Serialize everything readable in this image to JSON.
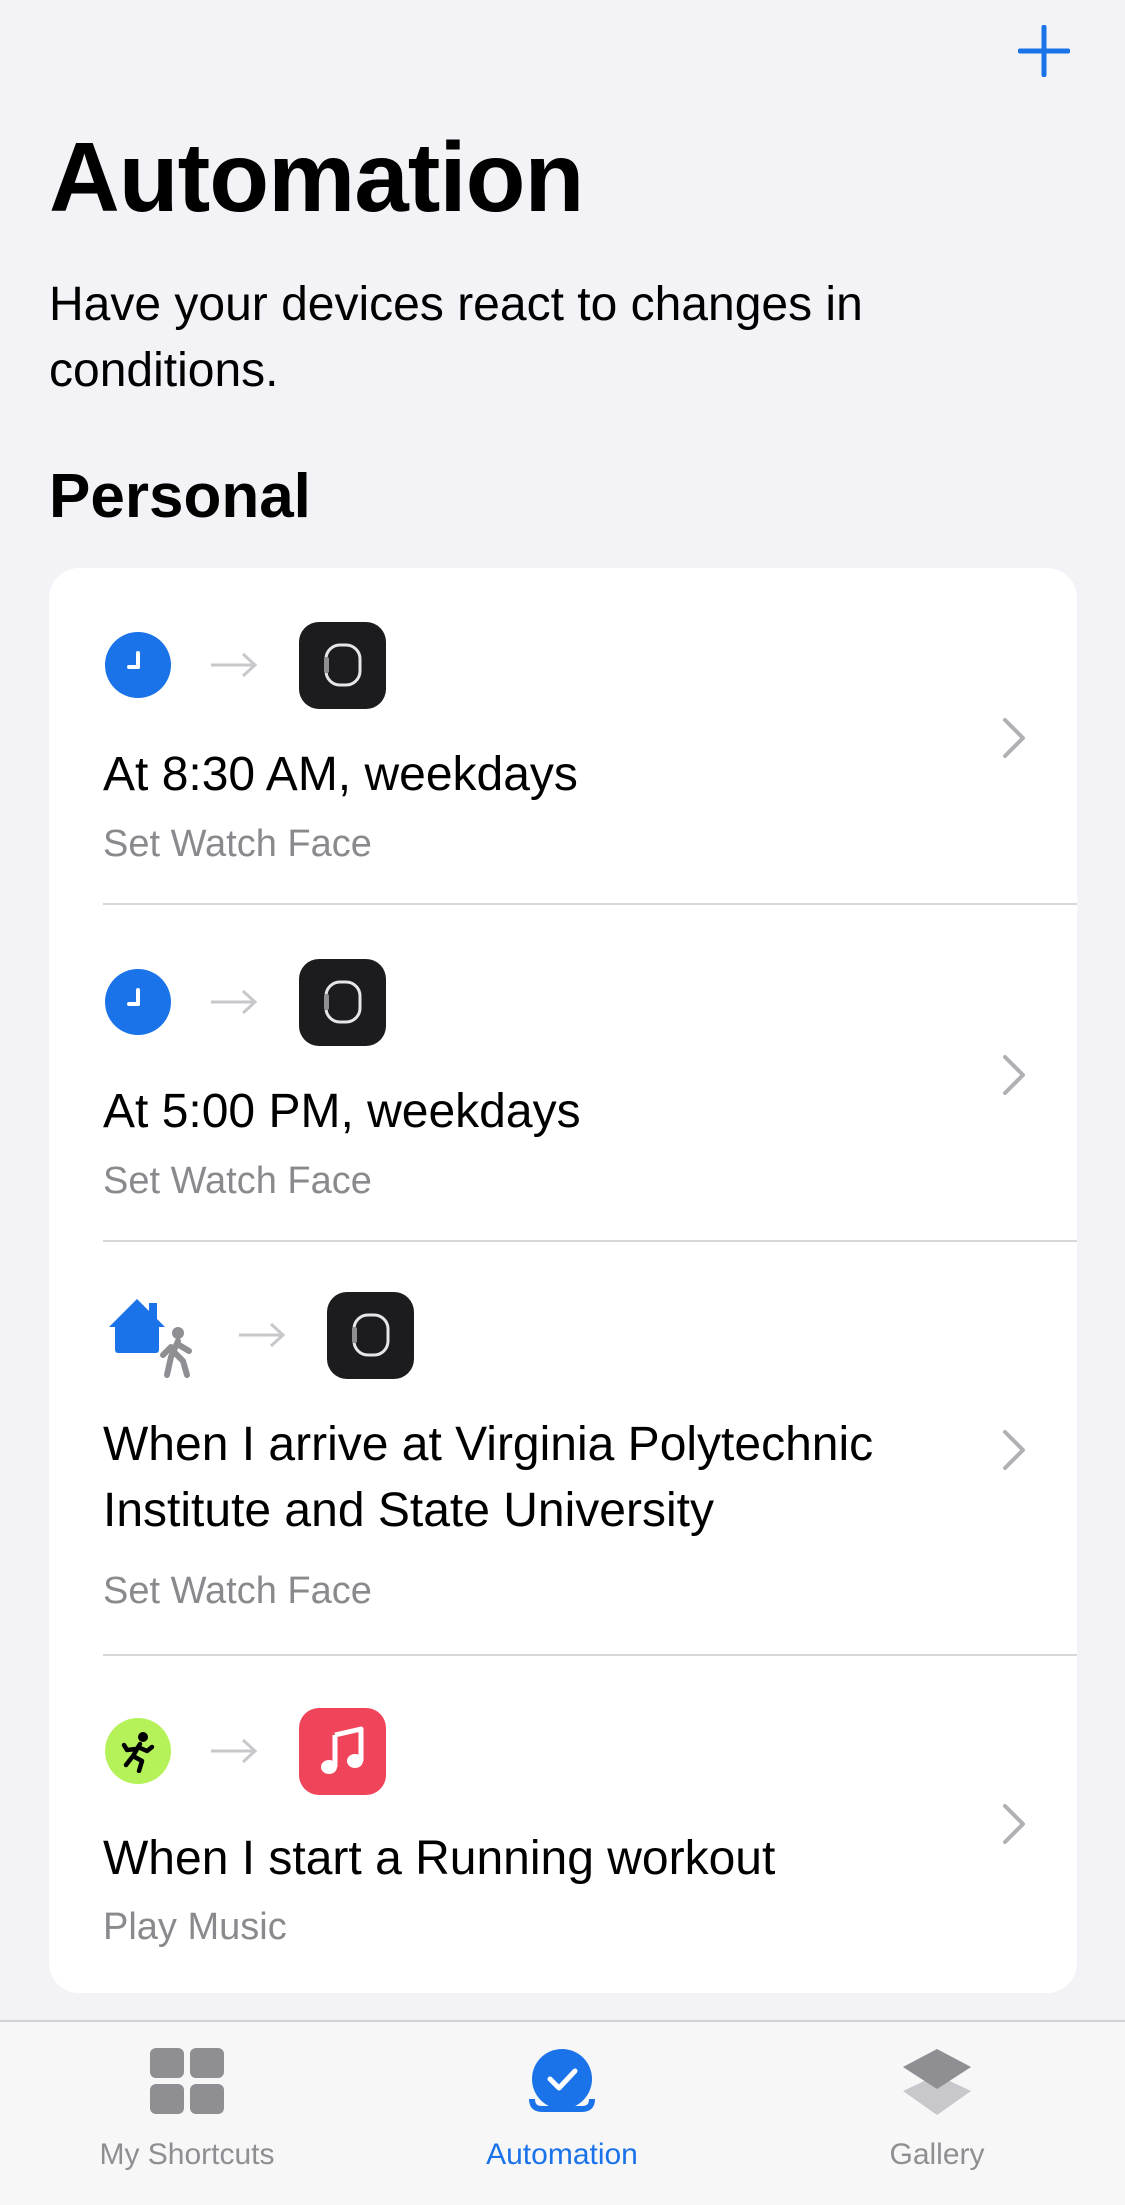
{
  "header": {
    "title": "Automation",
    "subtitle": "Have your devices react to changes in conditions."
  },
  "section": {
    "title": "Personal"
  },
  "automations": [
    {
      "trigger_icon": "clock-icon",
      "action_icon": "watch-face-icon",
      "title": "At 8:30 AM, weekdays",
      "action": "Set Watch Face"
    },
    {
      "trigger_icon": "clock-icon",
      "action_icon": "watch-face-icon",
      "title": "At 5:00 PM, weekdays",
      "action": "Set Watch Face"
    },
    {
      "trigger_icon": "arrive-home-icon",
      "action_icon": "watch-face-icon",
      "title": "When I arrive at Virginia Polytechnic Institute and State University",
      "action": "Set Watch Face"
    },
    {
      "trigger_icon": "workout-running-icon",
      "action_icon": "music-note-icon",
      "title": "When I start a Running workout",
      "action": "Play Music"
    }
  ],
  "tabbar": {
    "tabs": [
      {
        "label": "My Shortcuts",
        "icon": "grid-icon",
        "active": false
      },
      {
        "label": "Automation",
        "icon": "checkmark-icon",
        "active": true
      },
      {
        "label": "Gallery",
        "icon": "layers-icon",
        "active": false
      }
    ]
  },
  "colors": {
    "accent": "#1a73e8",
    "background": "#f2f2f7",
    "card": "#ffffff",
    "secondary_text": "#8a8a8e",
    "music_red": "#f0445a",
    "fitness_green": "#b5f25a"
  }
}
